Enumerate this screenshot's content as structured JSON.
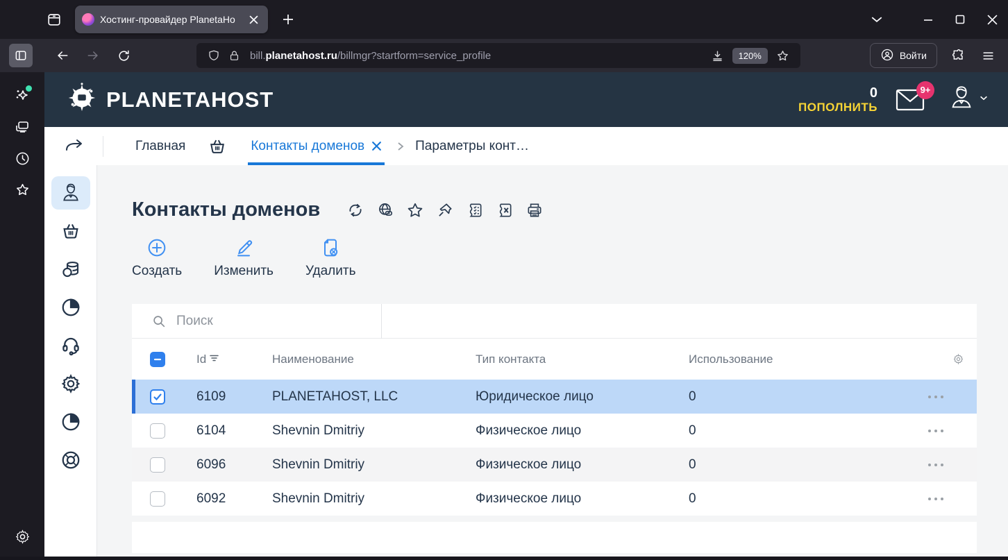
{
  "browser": {
    "tab_title": "Хостинг-провайдер PlanetaHo",
    "url": {
      "prefix": "bill.",
      "domain": "planetahost.ru",
      "path": "/billmgr?startform=service_profile"
    },
    "zoom_level": "120%",
    "login_label": "Войти"
  },
  "site_header": {
    "logo_text": "PLANETAHOST",
    "balance": "0",
    "topup_label": "ПОПОЛНИТЬ",
    "mail_badge": "9+"
  },
  "breadcrumb": {
    "home": "Главная",
    "active_tab": "Контакты доменов",
    "next_tab": "Параметры конт…"
  },
  "page": {
    "title": "Контакты доменов"
  },
  "actions": {
    "create": "Создать",
    "edit": "Изменить",
    "delete": "Удалить"
  },
  "search": {
    "placeholder": "Поиск"
  },
  "table": {
    "columns": {
      "id": "Id",
      "name": "Наименование",
      "type": "Тип контакта",
      "usage": "Использование"
    },
    "rows": [
      {
        "id": "6109",
        "name": "PLANETAHOST, LLC",
        "type": "Юридическое лицо",
        "usage": "0",
        "selected": true
      },
      {
        "id": "6104",
        "name": "Shevnin Dmitriy",
        "type": "Физическое лицо",
        "usage": "0",
        "selected": false
      },
      {
        "id": "6096",
        "name": "Shevnin Dmitriy",
        "type": "Физическое лицо",
        "usage": "0",
        "selected": false
      },
      {
        "id": "6092",
        "name": "Shevnin Dmitriy",
        "type": "Физическое лицо",
        "usage": "0",
        "selected": false
      }
    ]
  },
  "colors": {
    "header_navy": "#253443",
    "accent_blue": "#1878d8",
    "action_icon_blue": "#4090f2",
    "topup_yellow": "#f7d435",
    "badge_pink": "#e6336e",
    "selected_row": "#bdd8f8",
    "selected_stripe": "#2c6fd6",
    "chrome_dark": "#1c1b22",
    "toolbar_dark": "#2b2a33"
  }
}
